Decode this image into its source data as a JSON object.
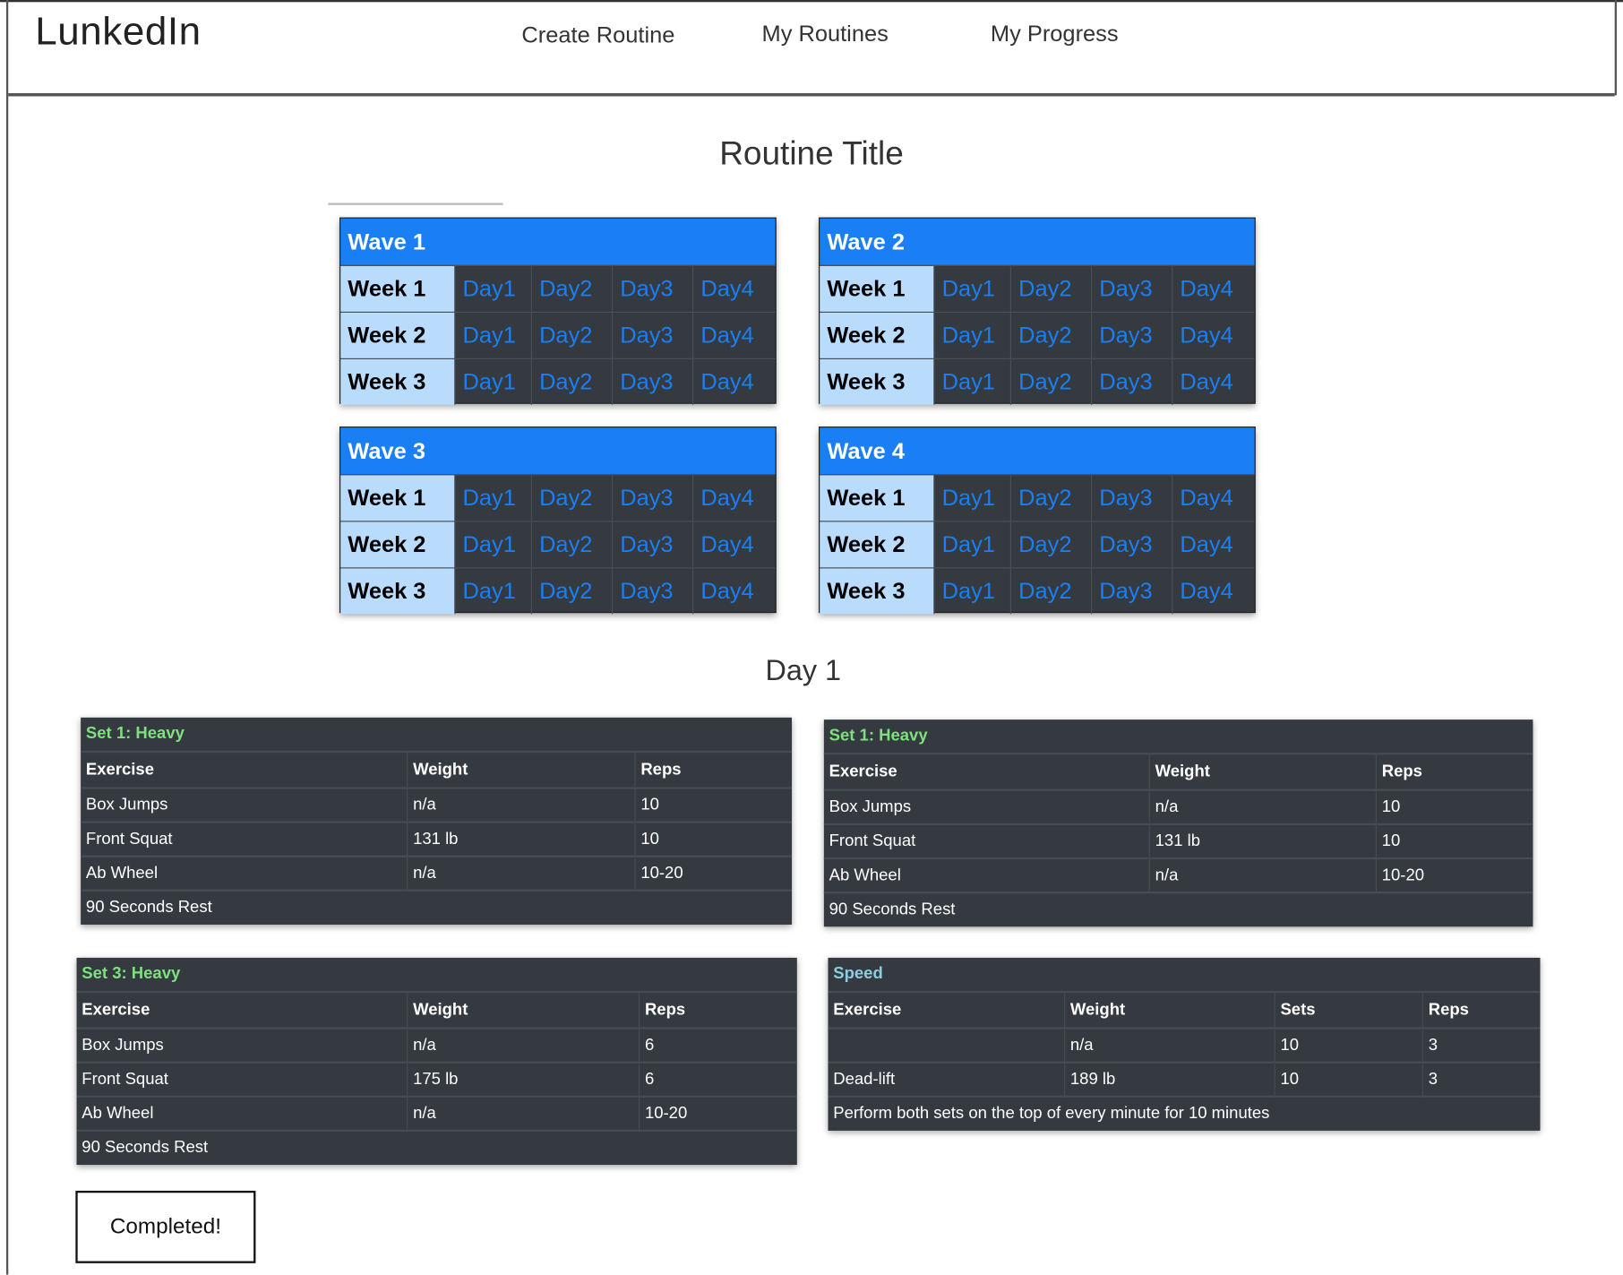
{
  "header": {
    "logo": "LunkedIn",
    "nav": [
      {
        "label": "Create Routine"
      },
      {
        "label": "My Routines"
      },
      {
        "label": "My Progress"
      }
    ]
  },
  "routine": {
    "title": "Routine Title",
    "waves": [
      {
        "label": "Wave 1",
        "weeks": [
          "Week 1",
          "Week 2",
          "Week 3"
        ],
        "days": [
          "Day1",
          "Day2",
          "Day3",
          "Day4"
        ]
      },
      {
        "label": "Wave 2",
        "weeks": [
          "Week 1",
          "Week 2",
          "Week 3"
        ],
        "days": [
          "Day1",
          "Day2",
          "Day3",
          "Day4"
        ]
      },
      {
        "label": "Wave 3",
        "weeks": [
          "Week 1",
          "Week 2",
          "Week 3"
        ],
        "days": [
          "Day1",
          "Day2",
          "Day3",
          "Day4"
        ]
      },
      {
        "label": "Wave 4",
        "weeks": [
          "Week 1",
          "Week 2",
          "Week 3"
        ],
        "days": [
          "Day1",
          "Day2",
          "Day3",
          "Day4"
        ]
      }
    ]
  },
  "day": {
    "title": "Day 1",
    "sets": [
      {
        "title": "Set 1: Heavy",
        "title_color": "#7ee07e",
        "columns": [
          "Exercise",
          "Weight",
          "Reps"
        ],
        "rows": [
          [
            "Box Jumps",
            "n/a",
            "10"
          ],
          [
            "Front Squat",
            "131 lb",
            "10"
          ],
          [
            "Ab Wheel",
            "n/a",
            "10-20"
          ]
        ],
        "note": "90 Seconds Rest"
      },
      {
        "title": "Set 1: Heavy",
        "title_color": "#7ee07e",
        "columns": [
          "Exercise",
          "Weight",
          "Reps"
        ],
        "rows": [
          [
            "Box Jumps",
            "n/a",
            "10"
          ],
          [
            "Front Squat",
            "131 lb",
            "10"
          ],
          [
            "Ab Wheel",
            "n/a",
            "10-20"
          ]
        ],
        "note": "90 Seconds Rest"
      },
      {
        "title": "Set 3: Heavy",
        "title_color": "#7ee07e",
        "columns": [
          "Exercise",
          "Weight",
          "Reps"
        ],
        "rows": [
          [
            "Box Jumps",
            "n/a",
            "6"
          ],
          [
            "Front Squat",
            "175 lb",
            "6"
          ],
          [
            "Ab Wheel",
            "n/a",
            "10-20"
          ]
        ],
        "note": "90 Seconds Rest"
      },
      {
        "title": "Speed",
        "title_color": "#8ecde0",
        "columns": [
          "Exercise",
          "Weight",
          "Sets",
          "Reps"
        ],
        "rows": [
          [
            "",
            "n/a",
            "10",
            "3"
          ],
          [
            "Dead-lift",
            "189 lb",
            "10",
            "3"
          ]
        ],
        "note": "Perform both sets on the top of every minute for 10 minutes"
      }
    ],
    "completed_label": "Completed!"
  },
  "colors": {
    "wave_header": "#1a7ff5",
    "week_cell": "#b9dcfd",
    "day_link": "#1a7ff5",
    "table_bg": "#343a40"
  }
}
